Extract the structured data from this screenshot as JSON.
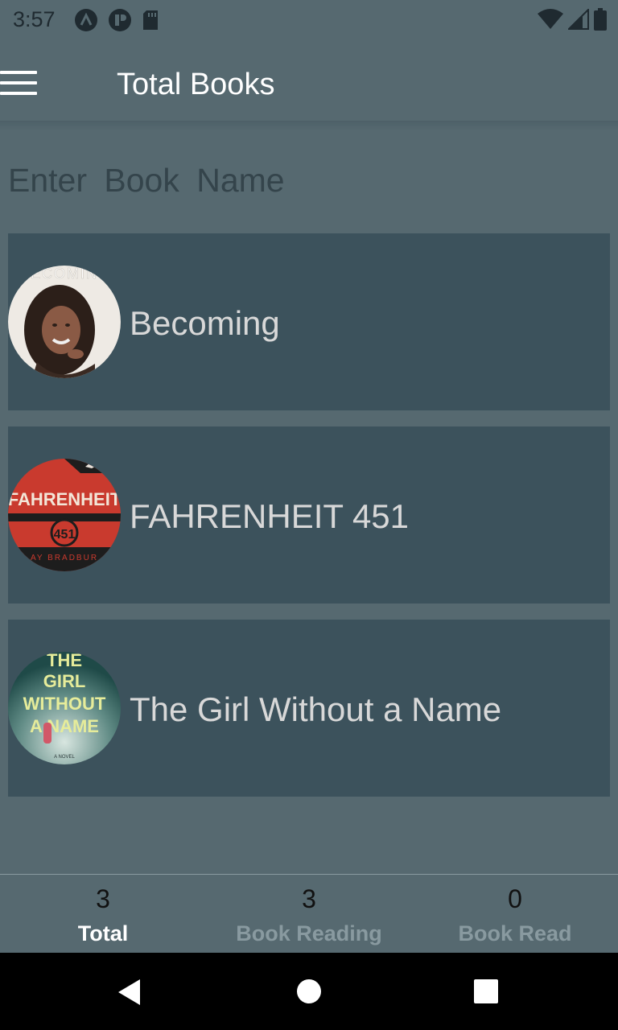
{
  "status_bar": {
    "time": "3:57",
    "left_icons": [
      "arch-icon",
      "shield-icon",
      "sd-card-icon"
    ],
    "right_icons": [
      "wifi-icon",
      "signal-icon",
      "battery-icon"
    ]
  },
  "app_bar": {
    "title": "Total Books",
    "menu_icon": "hamburger-menu-icon"
  },
  "search": {
    "placeholder": "Enter Book Name",
    "value": ""
  },
  "books": [
    {
      "title": "Becoming",
      "cover_text": "BECOMING",
      "cover_colors": [
        "#f0ece6",
        "#3a2a22"
      ]
    },
    {
      "title": "FAHRENHEIT 451",
      "cover_text": "FAHRENHEIT",
      "cover_number": "451",
      "cover_footer": "RAY BRADBURY",
      "cover_colors": [
        "#c93a2e",
        "#1d1d1d"
      ]
    },
    {
      "title": "The Girl Without a Name",
      "cover_text_lines": [
        "THE",
        "GIRL",
        "WITHOUT",
        "A NAME"
      ],
      "cover_colors": [
        "#2e5b5a",
        "#c8d8d0"
      ]
    }
  ],
  "bottom_nav": {
    "tabs": [
      {
        "count": "3",
        "label": "Total",
        "active": true
      },
      {
        "count": "3",
        "label": "Book Reading",
        "active": false
      },
      {
        "count": "0",
        "label": "Book Read",
        "active": false
      }
    ]
  },
  "system_nav": {
    "icons": [
      "back-icon",
      "home-icon",
      "recents-icon"
    ]
  },
  "colors": {
    "background": "#566970",
    "card": "#3c525c",
    "title_text": "#ffffff",
    "inactive_tab": "#899aa0"
  }
}
